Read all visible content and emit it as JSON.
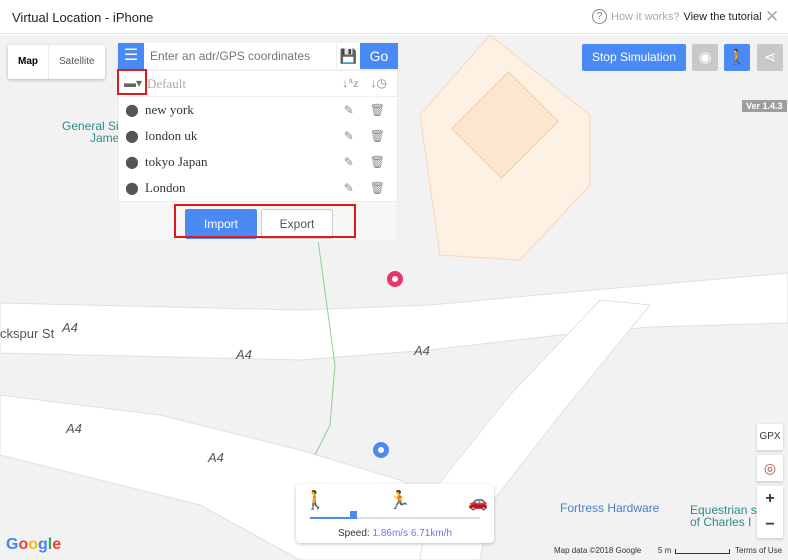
{
  "window": {
    "title": "Virtual Location - iPhone",
    "help_text": "How it works?",
    "tutorial_link": "View the tutorial"
  },
  "map_type": {
    "map": "Map",
    "satellite": "Satellite"
  },
  "search": {
    "placeholder": "Enter an adr/GPS coordinates",
    "go": "Go"
  },
  "list": {
    "group": "Default",
    "items": [
      {
        "label": "new york"
      },
      {
        "label": "london uk"
      },
      {
        "label": "tokyo Japan"
      },
      {
        "label": "London"
      }
    ],
    "import": "Import",
    "export": "Export"
  },
  "toolbar": {
    "stop": "Stop Simulation",
    "version": "Ver 1.4.3"
  },
  "map_labels": {
    "place1a": "General Si",
    "place1b": "Jame",
    "street": "ckspur St",
    "road": "A4",
    "poi1": "Fortress Hardware",
    "poi2a": "Equestrian st",
    "poi2b": "of Charles I"
  },
  "controls": {
    "gpx": "GPX",
    "zoom_in": "+",
    "zoom_out": "−"
  },
  "speed": {
    "label": "Speed:",
    "value": "1.86m/s 6.71km/h",
    "level": 0.25
  },
  "footer": {
    "map_data": "Map data ©2018 Google",
    "scale": "5 m",
    "terms": "Terms of Use",
    "logo": "Google"
  },
  "colors": {
    "accent": "#4a8af4",
    "highlight": "#e0191b"
  }
}
